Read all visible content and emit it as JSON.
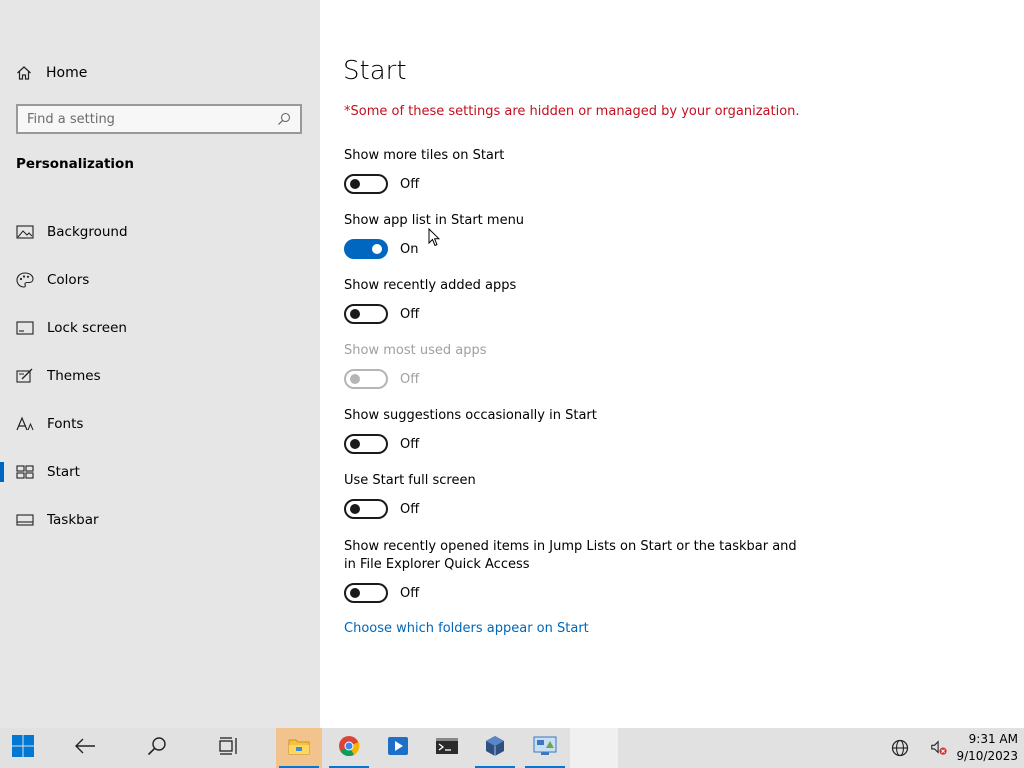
{
  "sidebar": {
    "home_label": "Home",
    "search_placeholder": "Find a setting",
    "section_title": "Personalization",
    "items": [
      {
        "label": "Background",
        "icon": "picture-icon"
      },
      {
        "label": "Colors",
        "icon": "palette-icon"
      },
      {
        "label": "Lock screen",
        "icon": "lock-screen-icon"
      },
      {
        "label": "Themes",
        "icon": "themes-icon"
      },
      {
        "label": "Fonts",
        "icon": "fonts-icon"
      },
      {
        "label": "Start",
        "icon": "start-icon",
        "active": true
      },
      {
        "label": "Taskbar",
        "icon": "taskbar-icon"
      }
    ]
  },
  "main": {
    "title": "Start",
    "notice": "*Some of these settings are hidden or managed by your organization.",
    "settings": [
      {
        "label": "Show more tiles on Start",
        "state": "Off",
        "on": false,
        "enabled": true
      },
      {
        "label": "Show app list in Start menu",
        "state": "On",
        "on": true,
        "enabled": true
      },
      {
        "label": "Show recently added apps",
        "state": "Off",
        "on": false,
        "enabled": true
      },
      {
        "label": "Show most used apps",
        "state": "Off",
        "on": false,
        "enabled": false
      },
      {
        "label": "Show suggestions occasionally in Start",
        "state": "Off",
        "on": false,
        "enabled": true
      },
      {
        "label": "Use Start full screen",
        "state": "Off",
        "on": false,
        "enabled": true
      },
      {
        "label": "Show recently opened items in Jump Lists on Start or the taskbar and in File Explorer Quick Access",
        "state": "Off",
        "on": false,
        "enabled": true
      }
    ],
    "link": "Choose which folders appear on Start"
  },
  "taskbar": {
    "apps": [
      "start-icon",
      "back-icon",
      "search-icon",
      "task-view-icon",
      "file-explorer-icon",
      "chrome-icon",
      "media-player-icon",
      "terminal-icon",
      "virtualbox-icon",
      "control-panel-icon",
      "settings-icon"
    ],
    "time": "9:31 AM",
    "date": "9/10/2023"
  },
  "colors": {
    "accent": "#0067c0",
    "notice": "#c50f1f",
    "link": "#0067b8",
    "sidebar_bg": "#e6e6e6",
    "taskbar_bg": "#e1e1e1"
  }
}
